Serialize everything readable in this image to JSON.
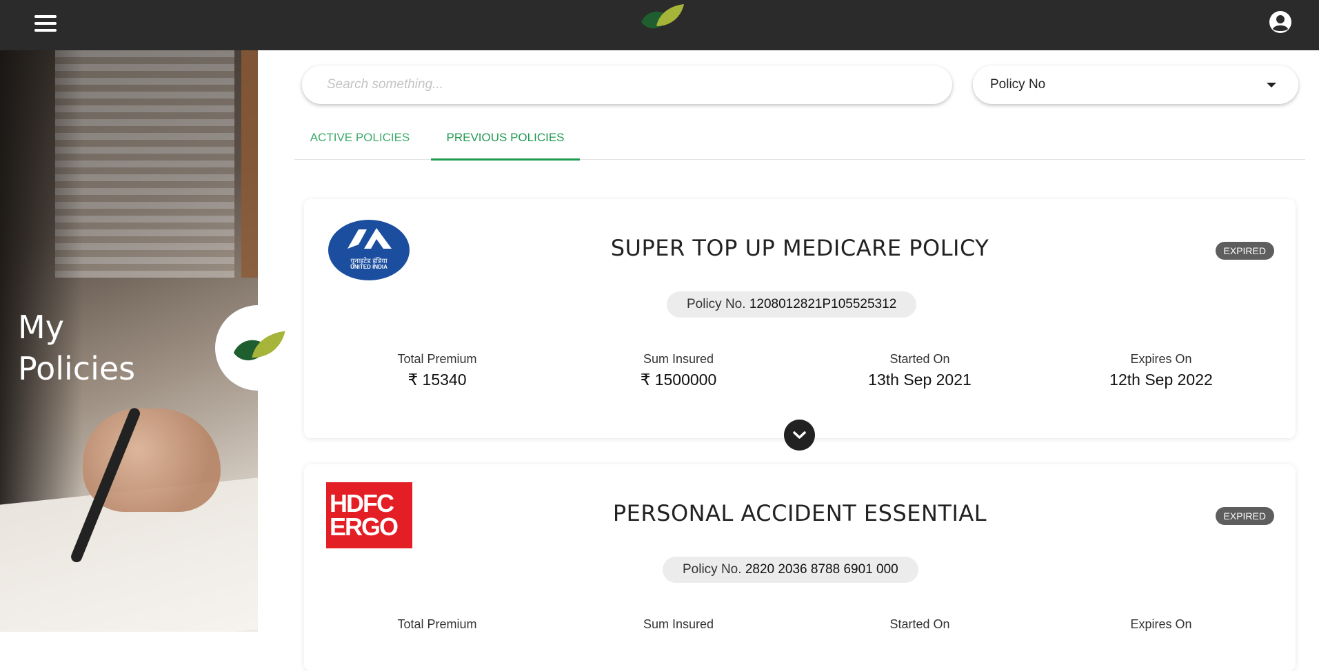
{
  "header": {
    "menu_icon": "hamburger-menu-icon",
    "logo_icon": "leaf-logo-icon",
    "account_icon": "user-account-icon"
  },
  "hero": {
    "title_line1": "My",
    "title_line2": "Policies"
  },
  "search": {
    "placeholder": "Search something..."
  },
  "filter": {
    "selected": "Policy No",
    "icon": "caret-down-icon"
  },
  "tabs": [
    {
      "label": "ACTIVE POLICIES",
      "active": false
    },
    {
      "label": "PREVIOUS POLICIES",
      "active": true
    }
  ],
  "labels": {
    "policy_no": "Policy No.",
    "total_premium": "Total Premium",
    "sum_insured": "Sum Insured",
    "started_on": "Started On",
    "expires_on": "Expires On"
  },
  "policies": [
    {
      "insurer_logo": "united-india-logo",
      "logo_text_hindi": "युनाइटेड इंडिया",
      "logo_text": "UNITED INDIA",
      "title": "SUPER TOP UP MEDICARE POLICY",
      "status": "EXPIRED",
      "policy_no": "1208012821P105525312",
      "total_premium": "₹ 15340",
      "sum_insured": "₹ 1500000",
      "started_on": "13th Sep 2021",
      "expires_on": "12th Sep 2022"
    },
    {
      "insurer_logo": "hdfc-ergo-logo",
      "logo_text_line1": "HDFC",
      "logo_text_line2": "ERGO",
      "title": "PERSONAL ACCIDENT ESSENTIAL",
      "status": "EXPIRED",
      "policy_no": "2820 2036 8788 6901 000"
    }
  ],
  "colors": {
    "topbar": "#2b2b2b",
    "accent_green": "#1f9a51",
    "status_badge": "#5e5e5e",
    "hdfc_red": "#e31e24",
    "uii_blue": "#1b4e9f"
  }
}
